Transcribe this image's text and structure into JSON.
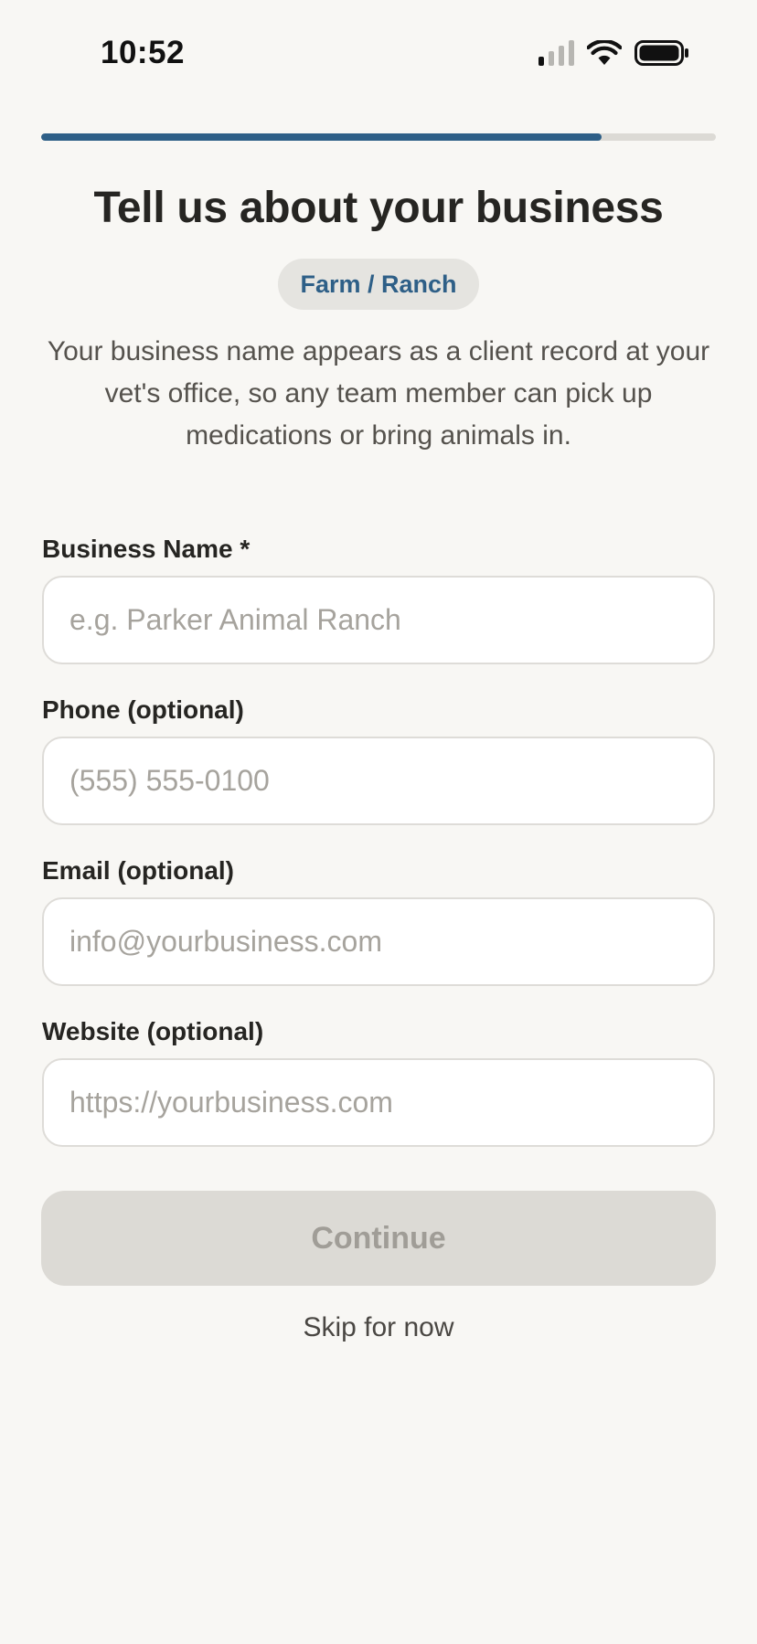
{
  "status_bar": {
    "time": "10:52",
    "icons": [
      "cellular-signal-icon",
      "wifi-icon",
      "battery-icon"
    ]
  },
  "progress": {
    "fraction": 0.83,
    "color": "#2e5f87"
  },
  "header": {
    "title": "Tell us about your business",
    "category_badge": "Farm / Ranch",
    "description": "Your business name appears as a client record at your vet's office, so any team member can pick up medications or bring animals in."
  },
  "form": {
    "fields": [
      {
        "label": "Business Name *",
        "placeholder": "e.g. Parker Animal Ranch",
        "value": ""
      },
      {
        "label": "Phone (optional)",
        "placeholder": "(555) 555-0100",
        "value": ""
      },
      {
        "label": "Email (optional)",
        "placeholder": "info@yourbusiness.com",
        "value": ""
      },
      {
        "label": "Website (optional)",
        "placeholder": "https://yourbusiness.com",
        "value": ""
      }
    ],
    "continue_label": "Continue",
    "skip_label": "Skip for now"
  },
  "colors": {
    "background": "#f8f7f4",
    "accent": "#2e5f87",
    "disabled_button": "#dcdad5"
  }
}
